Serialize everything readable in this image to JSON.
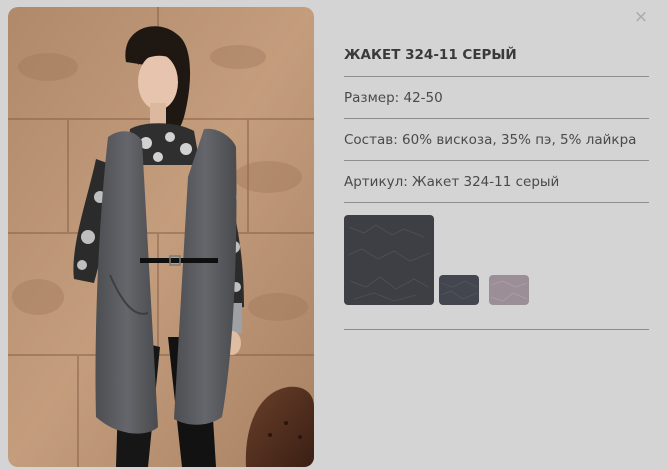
{
  "product": {
    "title": "ЖАКЕТ 324-11 СЕРЫЙ",
    "size": "Размер: 42-50",
    "composition": "Состав: 60% вискоза, 35% пэ, 5% лайкра",
    "article": "Артикул: Жакет 324-11 серый"
  },
  "close": {
    "glyph": "×",
    "icon": "close-icon"
  },
  "swatches": [
    {
      "name": "dark-gray",
      "color": "#3e3f45"
    },
    {
      "name": "graphite",
      "color": "#44464f"
    },
    {
      "name": "mauve-gray",
      "color": "#9b8e96"
    }
  ],
  "colors": {
    "background": "#d4d4d4",
    "divider": "#8e8e8e",
    "text": "#3a3a3a"
  }
}
